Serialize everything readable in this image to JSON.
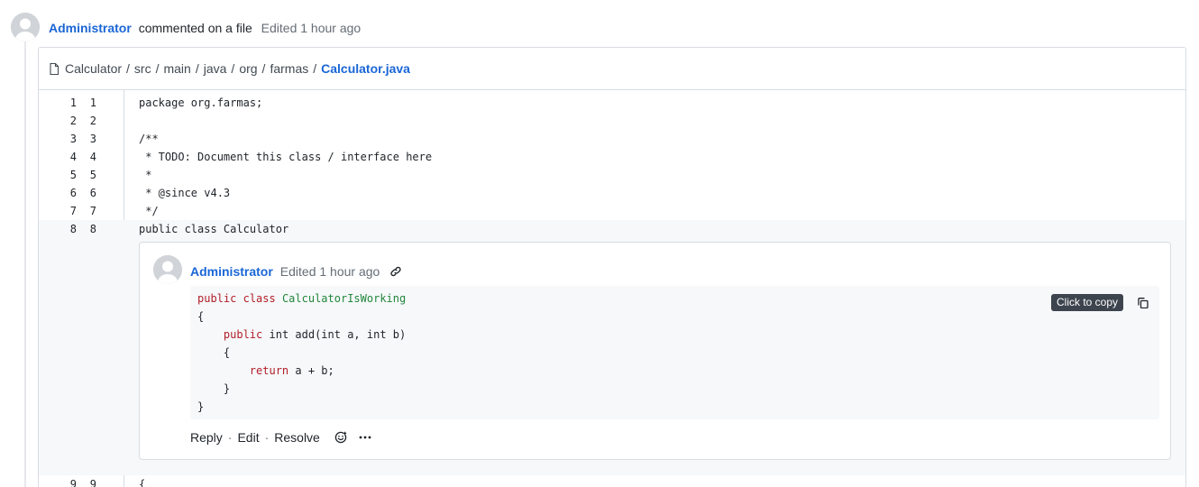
{
  "event": {
    "author": "Administrator",
    "action": "commented on a file",
    "edited": "Edited 1 hour ago"
  },
  "breadcrumb": {
    "parts": [
      "Calculator",
      "src",
      "main",
      "java",
      "org",
      "farmas"
    ],
    "separator": "/",
    "file": "Calculator.java"
  },
  "code_lines_before": [
    {
      "old": "1",
      "new": "1",
      "text": "package org.farmas;"
    },
    {
      "old": "2",
      "new": "2",
      "text": ""
    },
    {
      "old": "3",
      "new": "3",
      "text": "/**"
    },
    {
      "old": "4",
      "new": "4",
      "text": " * TODO: Document this class / interface here"
    },
    {
      "old": "5",
      "new": "5",
      "text": " *"
    },
    {
      "old": "6",
      "new": "6",
      "text": " * @since v4.3"
    },
    {
      "old": "7",
      "new": "7",
      "text": " */"
    },
    {
      "old": "8",
      "new": "8",
      "text": "public class Calculator"
    }
  ],
  "code_lines_after": [
    {
      "old": "9",
      "new": "9",
      "text": "{"
    }
  ],
  "comment": {
    "author": "Administrator",
    "edited": "Edited 1 hour ago",
    "code": {
      "l1_kw1": "public",
      "l1_kw2": "class",
      "l1_cls": "CalculatorIsWorking",
      "l2": "{",
      "l3_kw1": "public",
      "l3_rest": "int add(int a, int b)",
      "l4": "{",
      "l5_kw": "return",
      "l5_rest": "a + b;",
      "l6": "}",
      "l7": "}"
    },
    "copy_tooltip": "Click to copy",
    "actions": {
      "reply": "Reply",
      "edit": "Edit",
      "resolve": "Resolve",
      "separator": "·"
    }
  },
  "icons": {
    "avatar": "default-avatar-icon",
    "file": "file-icon",
    "link": "link-icon",
    "copy": "copy-icon",
    "emoji": "emoji-icon",
    "more": "more-icon"
  },
  "colors": {
    "link": "#1a66d6",
    "keyword": "#b31d28",
    "class_name": "#22863a",
    "tooltip_bg": "#3d444d"
  }
}
